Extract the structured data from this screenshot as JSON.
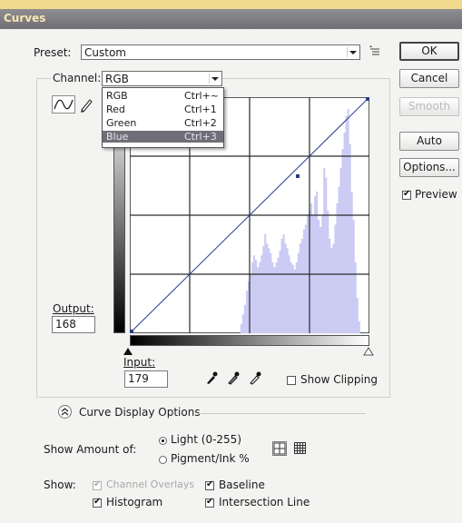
{
  "title": "Curves",
  "preset": {
    "label": "Preset:",
    "value": "Custom"
  },
  "channel": {
    "label": "Channel:",
    "value": "RGB",
    "options": [
      {
        "name": "RGB",
        "shortcut": "Ctrl+~"
      },
      {
        "name": "Red",
        "shortcut": "Ctrl+1"
      },
      {
        "name": "Green",
        "shortcut": "Ctrl+2"
      },
      {
        "name": "Blue",
        "shortcut": "Ctrl+3"
      }
    ],
    "highlighted": "Blue"
  },
  "buttons": {
    "ok": "OK",
    "cancel": "Cancel",
    "smooth": "Smooth",
    "auto": "Auto",
    "options": "Options..."
  },
  "preview": {
    "label": "Preview",
    "checked": true
  },
  "output": {
    "label": "Output:",
    "value": "168"
  },
  "input": {
    "label": "Input:",
    "value": "179"
  },
  "show_clipping": {
    "label": "Show Clipping",
    "checked": false
  },
  "curve_display_options": {
    "label": "Curve Display Options"
  },
  "show_amount": {
    "label": "Show Amount of:",
    "light": "Light  (0-255)",
    "pigment": "Pigment/Ink %",
    "selected": "light"
  },
  "show": {
    "label": "Show:",
    "channel_overlays": "Channel Overlays",
    "baseline": "Baseline",
    "histogram": "Histogram",
    "intersection_line": "Intersection Line"
  },
  "colors": {
    "histogram": "#cbcbf4",
    "curve": "#2a3d8a",
    "title_text": "#f7e6b3"
  },
  "histogram_levels": [
    0,
    0,
    0,
    0,
    0,
    0,
    0,
    0,
    0,
    0,
    0,
    0,
    0,
    0,
    0,
    0,
    0,
    0,
    0,
    0,
    0,
    0,
    0,
    0,
    0,
    0,
    0,
    0,
    0,
    0,
    0,
    0,
    0,
    0,
    0,
    0,
    0,
    0,
    0,
    0,
    0,
    0,
    0,
    0,
    0,
    0,
    0,
    0,
    0,
    0,
    0,
    0,
    0,
    0,
    0,
    0,
    0,
    0,
    0,
    0,
    0.04,
    0.08,
    0.12,
    0.18,
    0.22,
    0.25,
    0.3,
    0.33,
    0.31,
    0.28,
    0.3,
    0.33,
    0.37,
    0.42,
    0.38,
    0.36,
    0.34,
    0.3,
    0.28,
    0.3,
    0.32,
    0.35,
    0.4,
    0.42,
    0.38,
    0.36,
    0.33,
    0.3,
    0.29,
    0.27,
    0.3,
    0.34,
    0.38,
    0.4,
    0.44,
    0.46,
    0.5,
    0.52,
    0.55,
    0.5,
    0.58,
    0.6,
    0.48,
    0.45,
    0.5,
    0.7,
    0.66,
    0.52,
    0.4,
    0.36,
    0.38,
    0.46,
    0.55,
    0.62,
    0.7,
    0.78,
    0.85,
    0.92,
    0.95,
    0.8,
    0.6,
    0.48,
    0.3,
    0.15,
    0.05,
    0,
    0,
    0,
    0,
    0
  ]
}
